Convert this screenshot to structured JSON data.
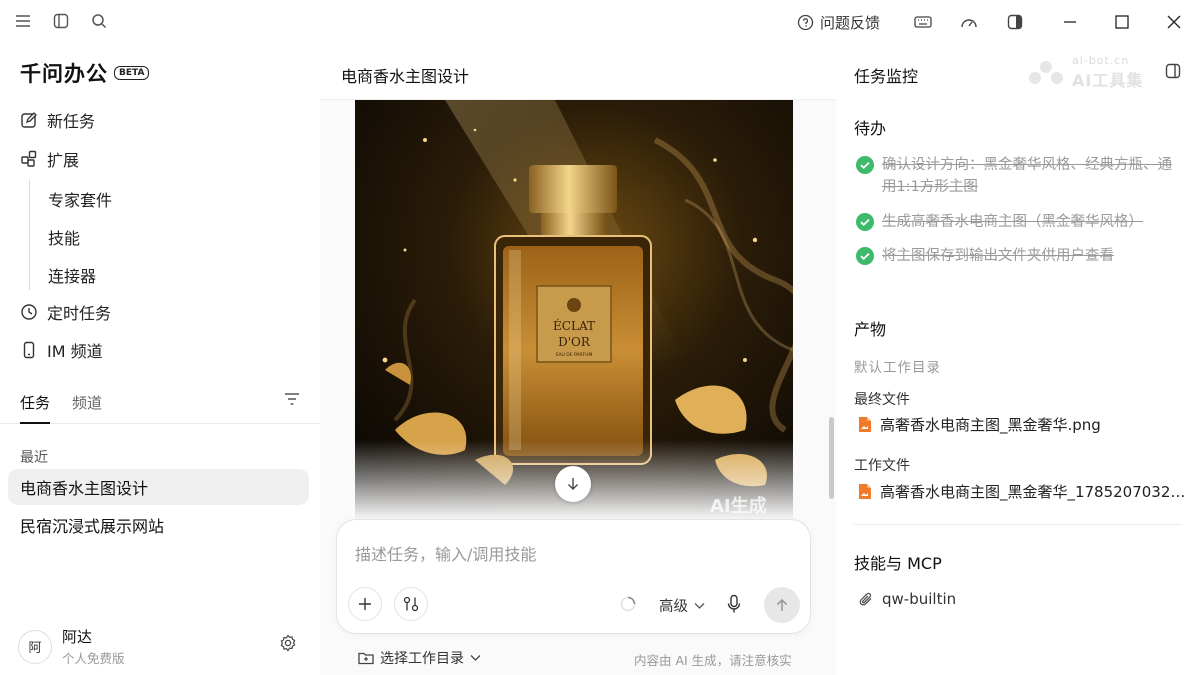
{
  "titlebar": {
    "feedback_label": "问题反馈"
  },
  "sidebar": {
    "brand": "千问办公",
    "beta": "BETA",
    "nav": {
      "new_task": "新任务",
      "extensions": "扩展",
      "expert_suite": "专家套件",
      "skills": "技能",
      "connectors": "连接器",
      "scheduled": "定时任务",
      "im_channel": "IM 频道"
    },
    "tabs": {
      "tasks": "任务",
      "channels": "频道"
    },
    "recent_label": "最近",
    "recent_tasks": [
      "电商香水主图设计",
      "民宿沉浸式展示网站"
    ],
    "user": {
      "avatar_text": "阿",
      "name": "阿达",
      "plan": "个人免费版"
    }
  },
  "center": {
    "title": "电商香水主图设计",
    "image": {
      "brand_line1": "ÉCLAT",
      "brand_line2": "D'OR",
      "brand_sub": "EAU DE PARFUM",
      "ai_mark": "AI生成"
    },
    "input": {
      "placeholder": "描述任务，输入/调用技能",
      "level": "高级"
    },
    "workdir_label": "选择工作目录",
    "disclaimer": "内容由 AI 生成，请注意核实"
  },
  "right_panel": {
    "title": "任务监控",
    "watermark": {
      "line1": "ai-bot.cn",
      "line2": "AI工具集"
    },
    "todo": {
      "heading": "待办",
      "items": [
        "确认设计方向：黑金奢华风格、经典方瓶、通用1:1方形主图",
        "生成高奢香水电商主图（黑金奢华风格）",
        "将主图保存到输出文件夹供用户查看"
      ]
    },
    "outputs": {
      "heading": "产物",
      "dir_label": "默认工作目录",
      "final_label": "最终文件",
      "final_file": "高奢香水电商主图_黑金奢华.png",
      "work_label": "工作文件",
      "work_file": "高奢香水电商主图_黑金奢华_1785207032...."
    },
    "skills": {
      "heading": "技能与 MCP",
      "item": "qw-builtin"
    }
  },
  "colors": {
    "check_green": "#3dbb6a",
    "file_orange": "#f07a2c",
    "active_task_bg": "#efefef"
  }
}
